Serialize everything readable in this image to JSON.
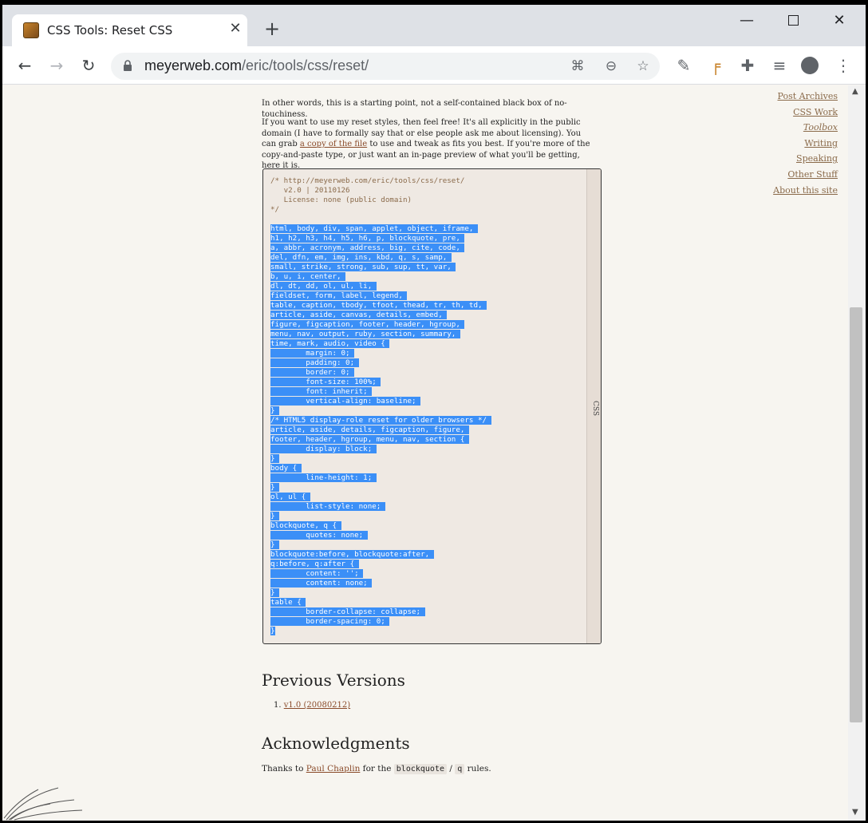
{
  "browser": {
    "tab_title": "CSS Tools: Reset CSS",
    "tab_close": "✕",
    "new_tab": "+",
    "url_host": "meyerweb.com",
    "url_path": "/eric/tools/css/reset/"
  },
  "intro": {
    "line1": "In other words, this is a starting point, not a self-contained black box of no-touchiness.",
    "p2_a": "If you want to use my reset styles, then feel free! It's all explicitly in the public domain (I have to formally say that or else people ask me about licensing). You can grab ",
    "p2_link": "a copy of the file",
    "p2_b": " to use and tweak as fits you best. If you're more of the copy-and-paste type, or just want an in-page preview of what you'll be getting, here it is."
  },
  "code": {
    "lang": "CSS",
    "header": "/* http://meyerweb.com/eric/tools/css/reset/\n   v2.0 | 20110126\n   License: none (public domain)\n*/",
    "selected_lines": [
      "html, body, div, span, applet, object, iframe,",
      "h1, h2, h3, h4, h5, h6, p, blockquote, pre,",
      "a, abbr, acronym, address, big, cite, code,",
      "del, dfn, em, img, ins, kbd, q, s, samp,",
      "small, strike, strong, sub, sup, tt, var,",
      "b, u, i, center,",
      "dl, dt, dd, ol, ul, li,",
      "fieldset, form, label, legend,",
      "table, caption, tbody, tfoot, thead, tr, th, td,",
      "article, aside, canvas, details, embed,",
      "figure, figcaption, footer, header, hgroup,",
      "menu, nav, output, ruby, section, summary,",
      "time, mark, audio, video {",
      "\tmargin: 0;",
      "\tpadding: 0;",
      "\tborder: 0;",
      "\tfont-size: 100%;",
      "\tfont: inherit;",
      "\tvertical-align: baseline;",
      "}",
      "/* HTML5 display-role reset for older browsers */",
      "article, aside, details, figcaption, figure,",
      "footer, header, hgroup, menu, nav, section {",
      "\tdisplay: block;",
      "}",
      "body {",
      "\tline-height: 1;",
      "}",
      "ol, ul {",
      "\tlist-style: none;",
      "}",
      "blockquote, q {",
      "\tquotes: none;",
      "}",
      "blockquote:before, blockquote:after,",
      "q:before, q:after {",
      "\tcontent: '';",
      "\tcontent: none;",
      "}",
      "table {",
      "\tborder-collapse: collapse;",
      "\tborder-spacing: 0;",
      "}"
    ]
  },
  "previous_versions": {
    "heading": "Previous Versions",
    "item_number": "1.",
    "item_link": "v1.0 (20080212)"
  },
  "acknowledgments": {
    "heading": "Acknowledgments",
    "text_a": "Thanks to ",
    "link": "Paul Chaplin",
    "text_b": " for the ",
    "code1": "blockquote",
    "sep": " / ",
    "code2": "q",
    "text_c": " rules."
  },
  "sidenav": {
    "items": [
      "Post Archives",
      "CSS Work",
      "Toolbox",
      "Writing",
      "Speaking",
      "Other Stuff",
      "About this site"
    ]
  }
}
